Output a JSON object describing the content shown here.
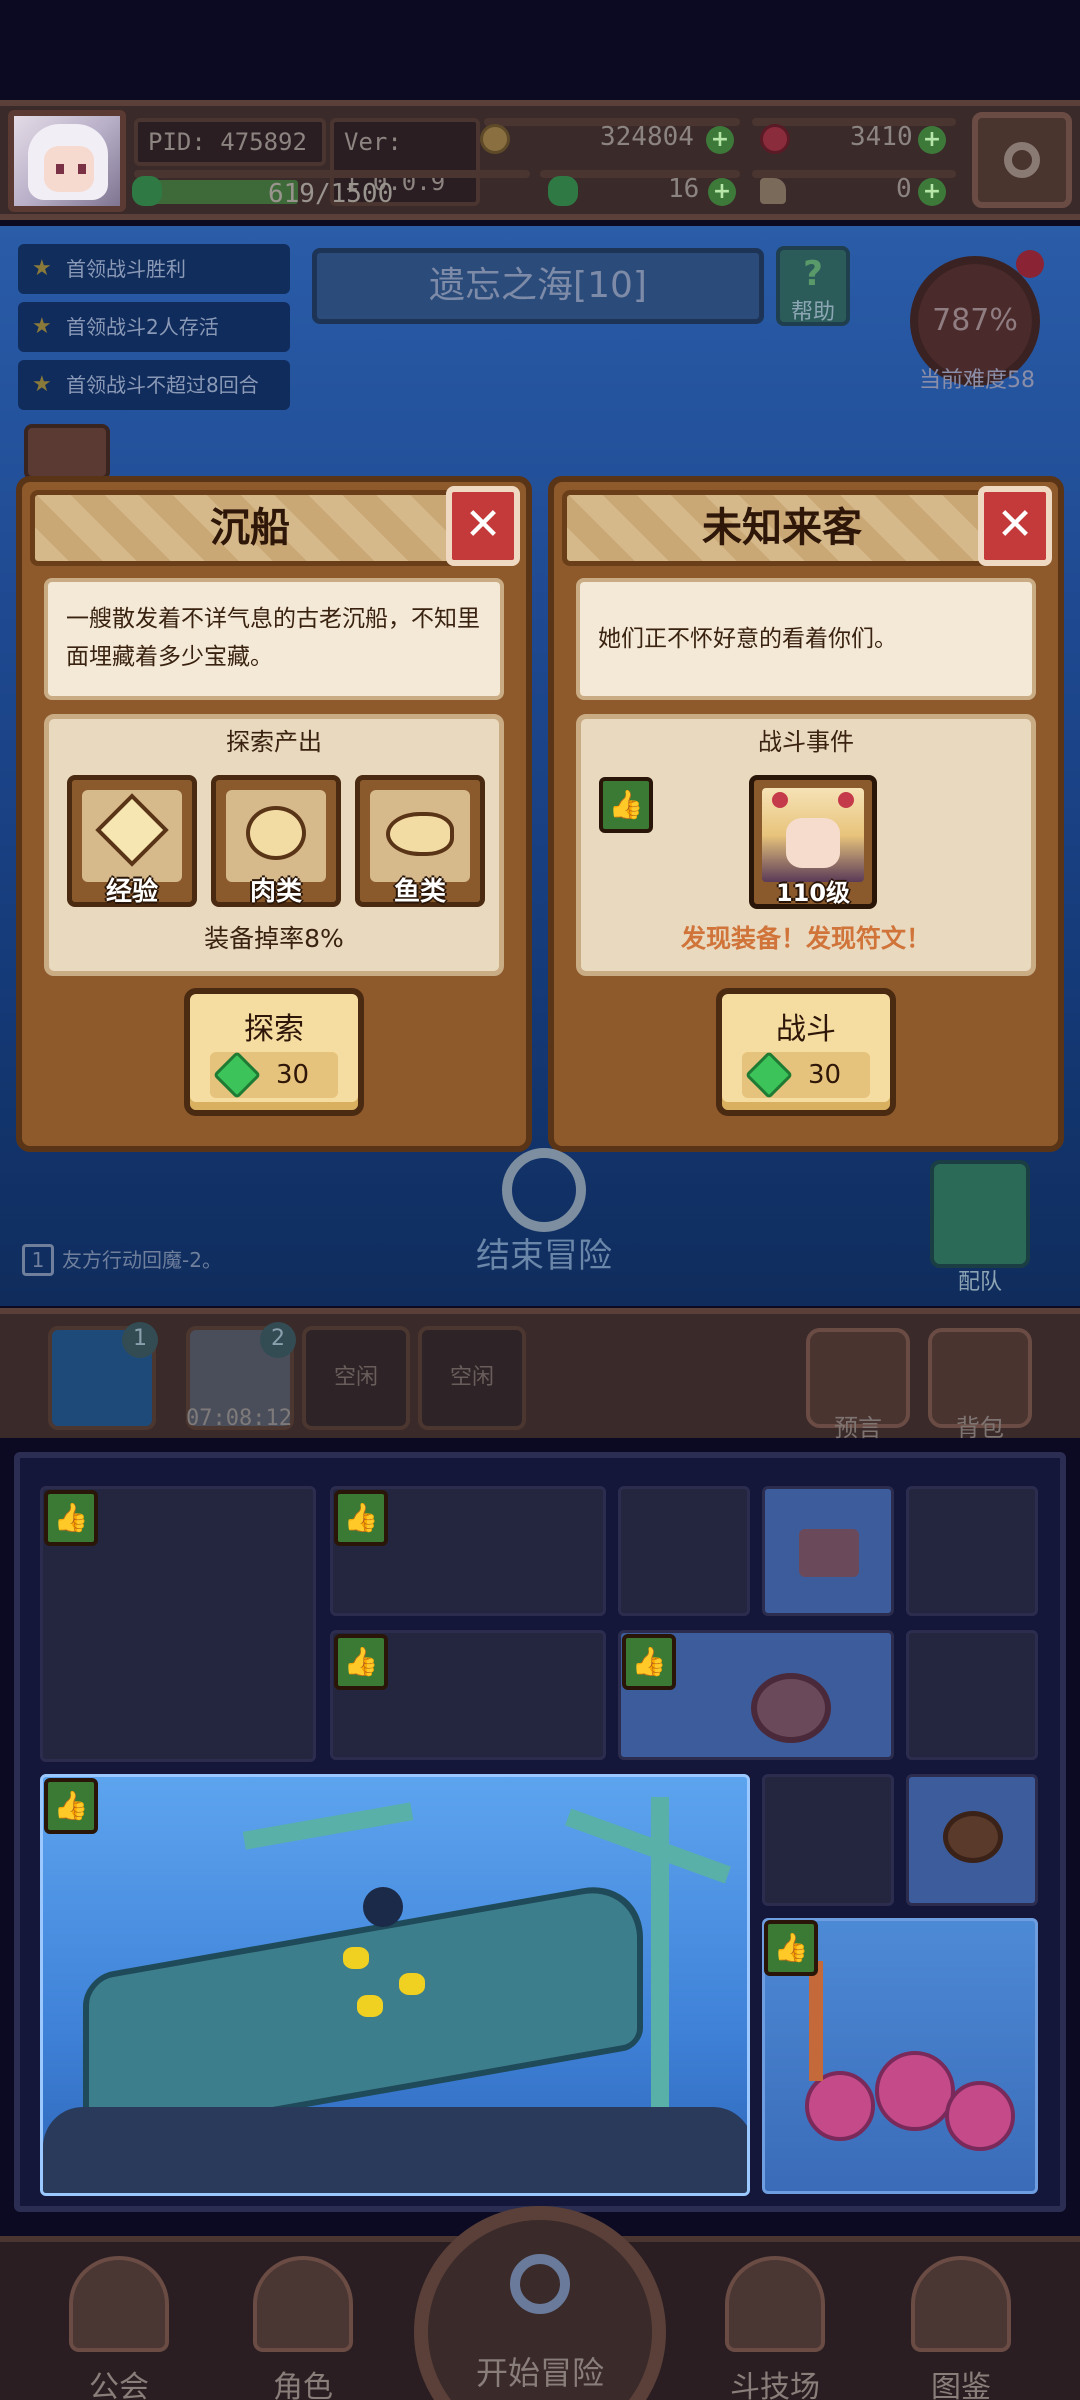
{
  "player": {
    "pid": "PID: 475892",
    "version": "Ver: 1.0.0.9",
    "exp": "619/1500",
    "exp_fraction": 0.41
  },
  "resources": {
    "gold": "324804",
    "ruby": "3410",
    "clover": "16",
    "boot": "0"
  },
  "quests": [
    "首领战斗胜利",
    "首领战斗2人存活",
    "首领战斗不超过8回合"
  ],
  "zone": {
    "title": "遗忘之海[10]",
    "help_label": "帮助",
    "help_glyph": "?",
    "difficulty_percent": "787%",
    "difficulty_label": "当前难度58"
  },
  "left_card": {
    "title": "沉船",
    "close": "✕",
    "description": "一艘散发着不详气息的古老沉船，不知里面埋藏着多少宝藏。",
    "panel_title": "探索产出",
    "rewards": [
      "经验",
      "肉类",
      "鱼类"
    ],
    "drop_rate": "装备掉率8%",
    "action_label": "探索",
    "cost": "30"
  },
  "right_card": {
    "title": "未知来客",
    "close": "✕",
    "description": "她们正不怀好意的看着你们。",
    "panel_title": "战斗事件",
    "enemy_level": "110级",
    "discover": "发现装备！发现符文！",
    "action_label": "战斗",
    "cost": "30"
  },
  "map": {
    "end_adventure": "结束冒险",
    "team": "配队",
    "turn_tip": "友方行动回魔-2。",
    "turn_num": "1"
  },
  "slots": {
    "slot1_num": "1",
    "slot2_num": "2",
    "timer": "07:08:12",
    "idle1": "空闲",
    "idle2": "空闲",
    "prophecy": "预言",
    "backpack": "背包"
  },
  "icons": {
    "thumb": "👍",
    "plus": "+"
  },
  "nav": {
    "guild": "公会",
    "character": "角色",
    "start": "开始冒险",
    "arena": "斗技场",
    "codex": "图鉴"
  },
  "colors": {
    "accent_green": "#3cc45a",
    "close_red": "#c43a3a",
    "discover_orange": "#d0743a",
    "card_brown": "#8e5a2c"
  }
}
